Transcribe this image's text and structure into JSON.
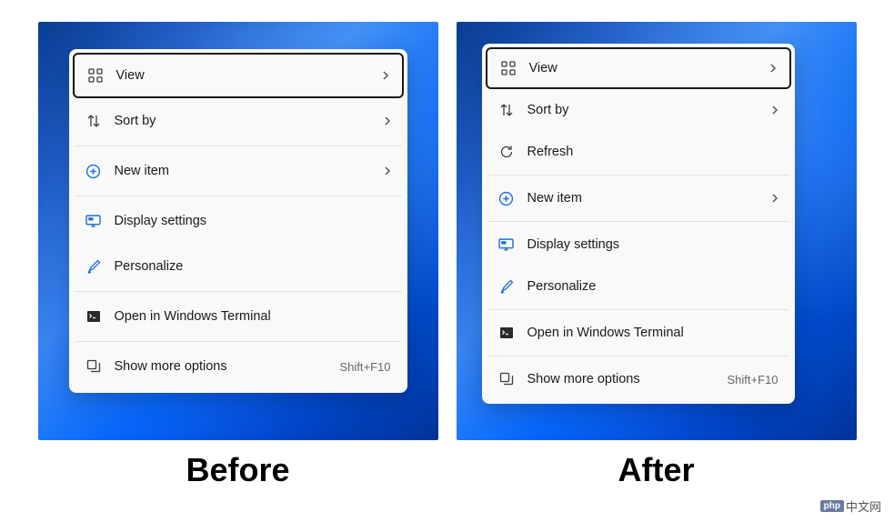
{
  "before": {
    "caption": "Before",
    "items": [
      {
        "label": "View",
        "icon": "grid-icon",
        "hasSubmenu": true,
        "highlighted": true
      },
      {
        "label": "Sort by",
        "icon": "sort-icon",
        "hasSubmenu": true
      },
      {
        "separator": true
      },
      {
        "label": "New item",
        "icon": "plus-circle-icon",
        "hasSubmenu": true
      },
      {
        "separator": true
      },
      {
        "label": "Display settings",
        "icon": "display-icon"
      },
      {
        "label": "Personalize",
        "icon": "brush-icon"
      },
      {
        "separator": true
      },
      {
        "label": "Open in Windows Terminal",
        "icon": "terminal-icon"
      },
      {
        "separator": true
      },
      {
        "label": "Show more options",
        "icon": "more-options-icon",
        "shortcut": "Shift+F10"
      }
    ]
  },
  "after": {
    "caption": "After",
    "items": [
      {
        "label": "View",
        "icon": "grid-icon",
        "hasSubmenu": true,
        "highlighted": true
      },
      {
        "label": "Sort by",
        "icon": "sort-icon",
        "hasSubmenu": true
      },
      {
        "label": "Refresh",
        "icon": "refresh-icon"
      },
      {
        "separator": true
      },
      {
        "label": "New item",
        "icon": "plus-circle-icon",
        "hasSubmenu": true
      },
      {
        "separator": true
      },
      {
        "label": "Display settings",
        "icon": "display-icon"
      },
      {
        "label": "Personalize",
        "icon": "brush-icon"
      },
      {
        "separator": true
      },
      {
        "label": "Open in Windows Terminal",
        "icon": "terminal-icon"
      },
      {
        "separator": true
      },
      {
        "label": "Show more options",
        "icon": "more-options-icon",
        "shortcut": "Shift+F10"
      }
    ]
  },
  "watermark": {
    "badge": "php",
    "text": "中文网"
  }
}
